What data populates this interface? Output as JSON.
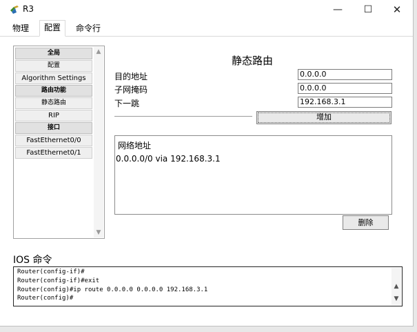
{
  "window": {
    "title": "R3",
    "minimize": "—",
    "maximize": "☐",
    "close": "✕"
  },
  "tabs": [
    "物理",
    "配置",
    "命令行"
  ],
  "nav": {
    "items": [
      {
        "label": "全局",
        "kind": "head"
      },
      {
        "label": "配置",
        "kind": "sub"
      },
      {
        "label": "Algorithm Settings",
        "kind": "normal"
      },
      {
        "label": "路由功能",
        "kind": "head"
      },
      {
        "label": "静态路由",
        "kind": "sub"
      },
      {
        "label": "RIP",
        "kind": "normal"
      },
      {
        "label": "接口",
        "kind": "head"
      },
      {
        "label": "FastEthernet0/0",
        "kind": "normal"
      },
      {
        "label": "FastEthernet0/1",
        "kind": "normal"
      }
    ]
  },
  "static_route": {
    "title": "静态路由",
    "dest_label": "目的地址",
    "dest_value": "0.0.0.0",
    "mask_label": "子网掩码",
    "mask_value": "0.0.0.0",
    "next_hop_label": "下一跳",
    "next_hop_value": "192.168.3.1",
    "add_button": "增加",
    "network_header": "网络地址",
    "routes": [
      "0.0.0.0/0 via 192.168.3.1"
    ],
    "delete_button": "删除"
  },
  "ios": {
    "label": "IOS 命令",
    "lines": [
      "Router(config-if)#",
      "Router(config-if)#exit",
      "Router(config)#ip route 0.0.0.0 0.0.0.0 192.168.3.1",
      "Router(config)#"
    ]
  }
}
